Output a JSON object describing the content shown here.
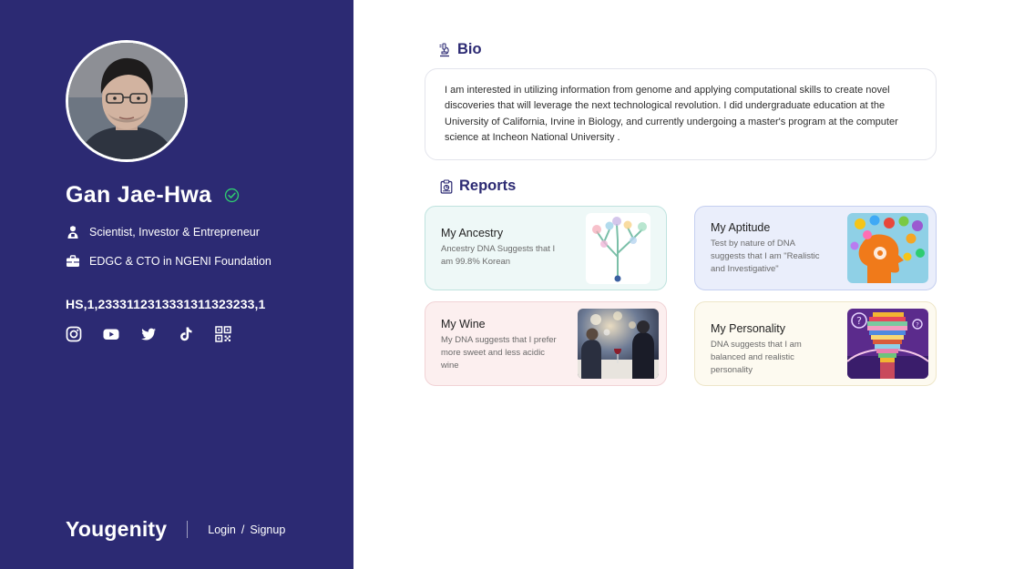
{
  "profile": {
    "name": "Gan Jae-Hwa",
    "title": "Scientist, Investor & Entrepreneur",
    "organization": "EDGC & CTO in NGENI Foundation",
    "hs_code": "HS,1,2333112313331311323233,1"
  },
  "socials": [
    "instagram-icon",
    "youtube-icon",
    "twitter-icon",
    "tiktok-icon",
    "qr-code-icon"
  ],
  "brand": {
    "name": "Yougenity",
    "login_label": "Login",
    "separator": "/",
    "signup_label": "Signup"
  },
  "bio": {
    "heading": "Bio",
    "text": "I am interested in utilizing information from genome and applying computational skills to create novel discoveries that will leverage the next technological revolution. I did undergraduate education at the University of California, Irvine in Biology, and currently undergoing a master's program at the computer science at Incheon National University ."
  },
  "reports": {
    "heading": "Reports",
    "items": [
      {
        "title": "My Ancestry",
        "description": "Ancestry DNA Suggests that I am 99.8% Korean",
        "color": "#eef8f7"
      },
      {
        "title": "My Aptitude",
        "description": "Test by nature of DNA suggests that I am \"Realistic and Investigative\"",
        "color": "#eaeefb"
      },
      {
        "title": "My Wine",
        "description": "My DNA suggests that I prefer more sweet and less acidic wine",
        "color": "#fcefef"
      },
      {
        "title": "My Personality",
        "description": "DNA suggests that I am balanced and realistic personality",
        "color": "#fdfaf0"
      }
    ]
  },
  "colors": {
    "sidebar_bg": "#2c2a73",
    "accent_green": "#2ecc71",
    "heading_navy": "#2c2a73"
  }
}
